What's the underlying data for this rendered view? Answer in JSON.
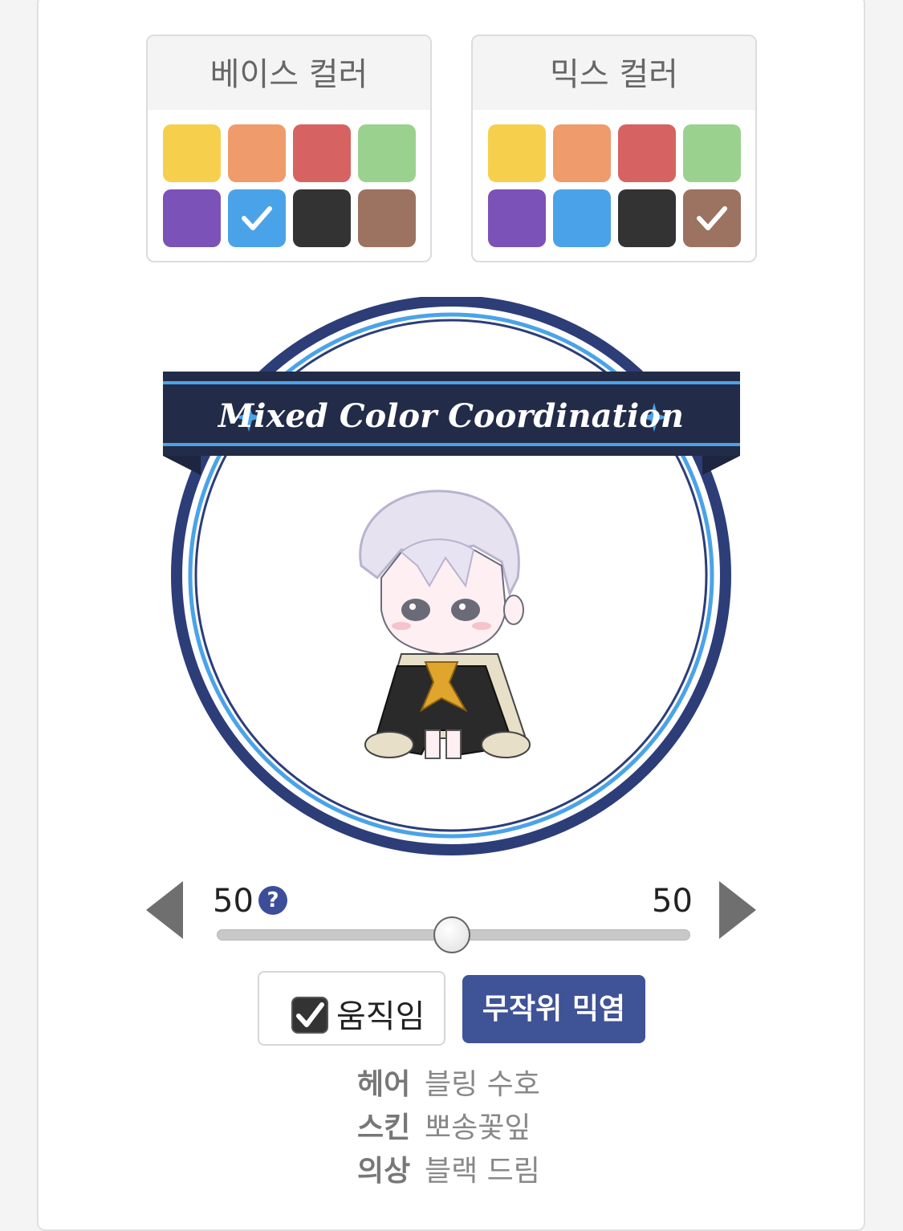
{
  "base_palette": {
    "title": "베이스 컬러",
    "swatches": [
      {
        "name": "yellow",
        "color": "#f6d04d",
        "selected": false
      },
      {
        "name": "orange",
        "color": "#f09b6b",
        "selected": false
      },
      {
        "name": "red",
        "color": "#d76262",
        "selected": false
      },
      {
        "name": "green",
        "color": "#9bd18f",
        "selected": false
      },
      {
        "name": "purple",
        "color": "#7b52b7",
        "selected": false
      },
      {
        "name": "blue",
        "color": "#4aa3e8",
        "selected": true
      },
      {
        "name": "black",
        "color": "#333333",
        "selected": false
      },
      {
        "name": "brown",
        "color": "#9c7260",
        "selected": false
      }
    ]
  },
  "mix_palette": {
    "title": "믹스 컬러",
    "swatches": [
      {
        "name": "yellow",
        "color": "#f6d04d",
        "selected": false
      },
      {
        "name": "orange",
        "color": "#f09b6b",
        "selected": false
      },
      {
        "name": "red",
        "color": "#d76262",
        "selected": false
      },
      {
        "name": "green",
        "color": "#9bd18f",
        "selected": false
      },
      {
        "name": "purple",
        "color": "#7b52b7",
        "selected": false
      },
      {
        "name": "blue",
        "color": "#4aa3e8",
        "selected": false
      },
      {
        "name": "black",
        "color": "#333333",
        "selected": false
      },
      {
        "name": "brown",
        "color": "#9c7260",
        "selected": true
      }
    ]
  },
  "banner": {
    "text": "Mixed Color Coordination"
  },
  "slider": {
    "left_value": "50",
    "right_value": "50",
    "ratio_percent": 50,
    "help_icon": "?"
  },
  "controls": {
    "motion_label": "움직임",
    "motion_checked": true,
    "random_button": "무작위 믹염"
  },
  "info": [
    {
      "key": "헤어",
      "value": "블링 수호"
    },
    {
      "key": "스킨",
      "value": "뽀송꽃잎"
    },
    {
      "key": "의상",
      "value": "블랙 드림"
    }
  ],
  "colors": {
    "accent": "#3f5397",
    "ring_dark": "#2d3d78",
    "ring_light": "#4aa3e8",
    "banner_bg": "#222c48"
  }
}
